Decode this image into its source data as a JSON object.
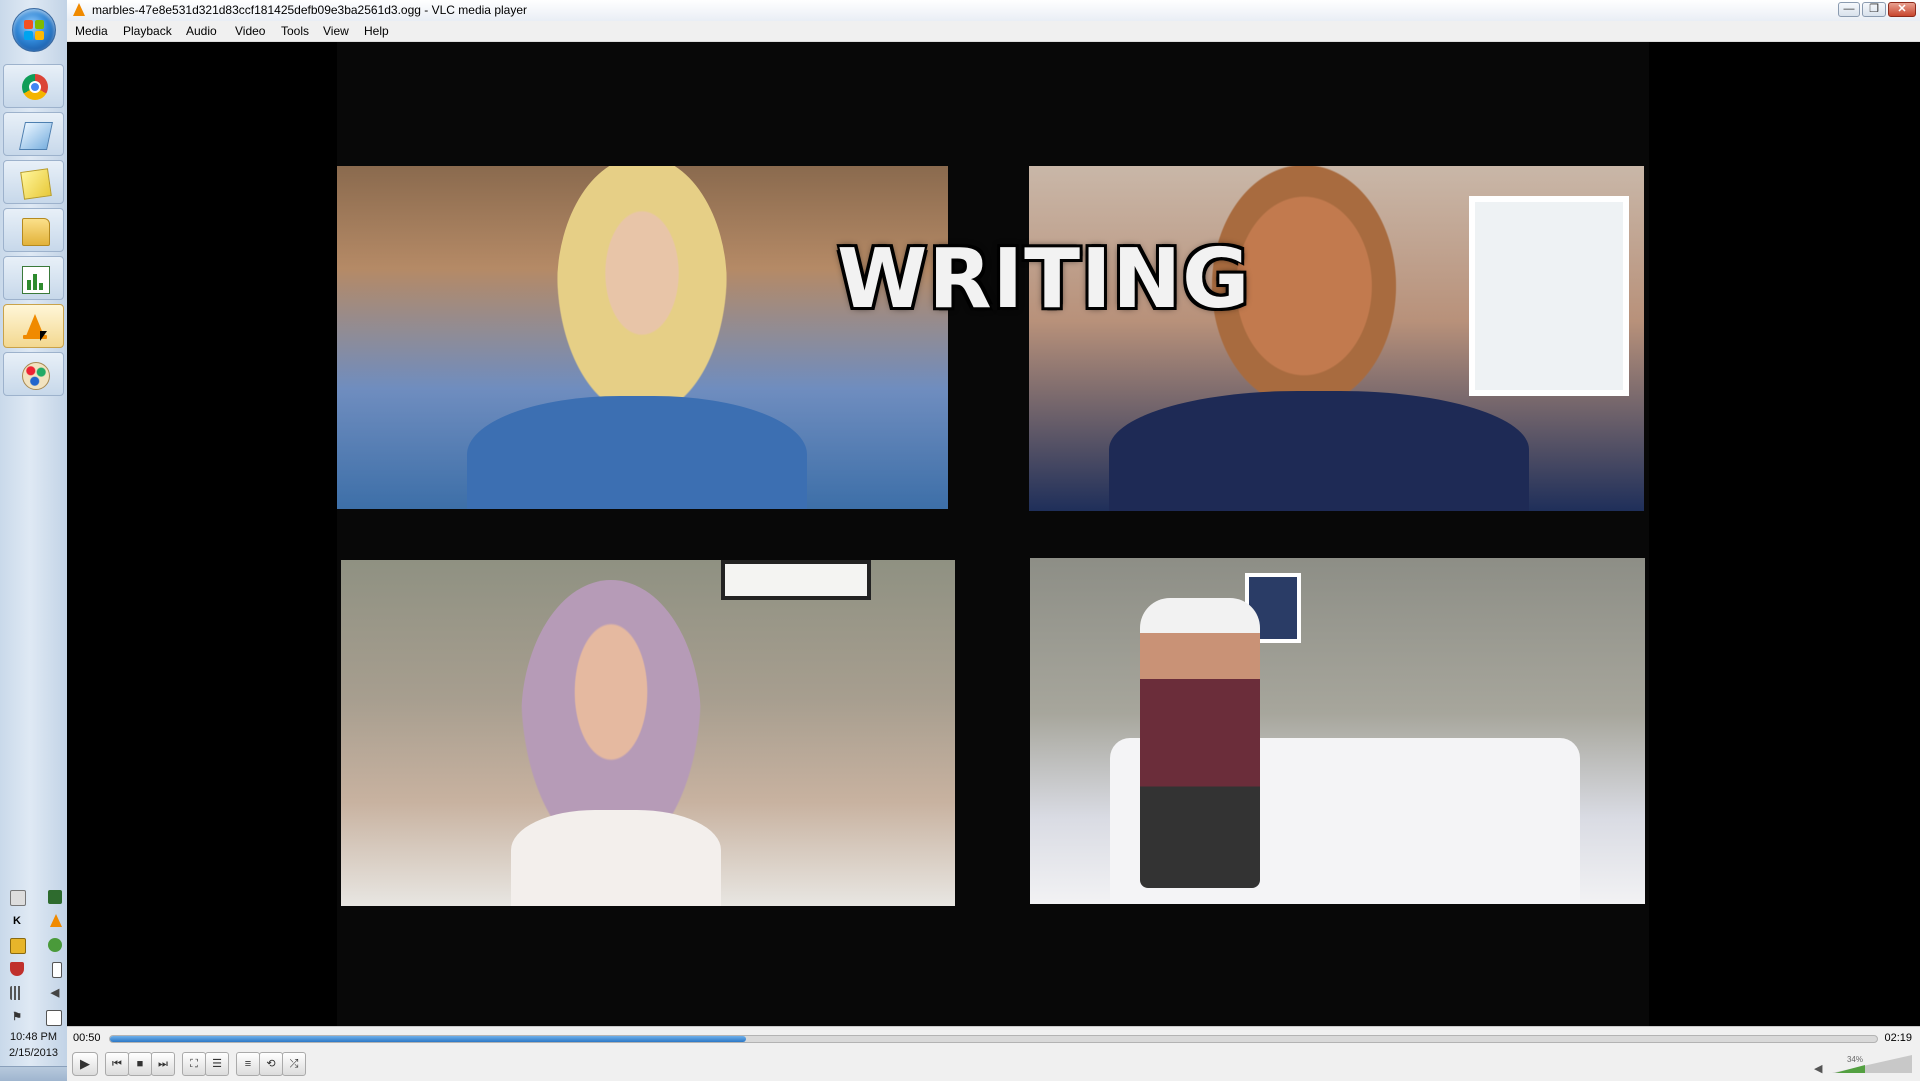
{
  "window": {
    "title": "marbles-47e8e531d321d83ccf181425defb09e3ba2561d3.ogg - VLC media player",
    "minimize_label": "—",
    "restore_label": "❐",
    "close_label": "✕"
  },
  "menu": {
    "items": [
      "Media",
      "Playback",
      "Audio",
      "Video",
      "Tools",
      "View",
      "Help"
    ]
  },
  "video": {
    "overlay_text": "WRITING"
  },
  "playback": {
    "elapsed": "00:50",
    "total": "02:19",
    "progress_fraction": 0.36,
    "volume": "34%",
    "volume_fraction": 0.34
  },
  "controls": {
    "play_icon": "play-icon",
    "prev_icon": "previous-icon",
    "stop_icon": "stop-icon",
    "next_icon": "next-icon",
    "fullscreen_icon": "fullscreen-icon",
    "extended_icon": "extended-settings-icon",
    "playlist_icon": "playlist-icon",
    "loop_icon": "loop-icon",
    "shuffle_icon": "shuffle-icon",
    "mute_icon": "speaker-icon"
  },
  "taskbar": {
    "apps": [
      "chrome-icon",
      "tablet-icon",
      "notes-icon",
      "folder-icon",
      "chart-app-icon",
      "vlc-icon",
      "paint-icon"
    ],
    "clock_time": "10:48 PM",
    "clock_date": "2/15/2013",
    "tray_hk_label": "K"
  },
  "colors": {
    "seek_fill": "#2c78c6",
    "vlc_orange": "#f08a00",
    "volume_fill": "#53a041"
  }
}
